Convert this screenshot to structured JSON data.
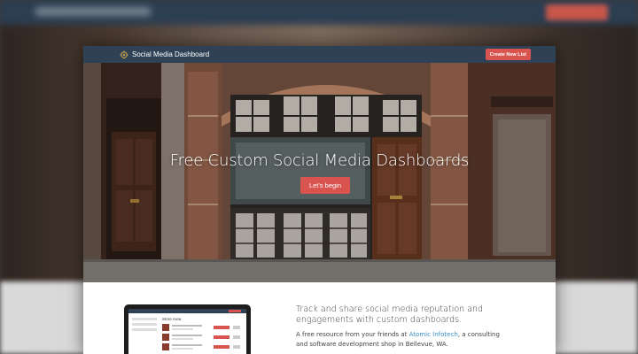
{
  "navbar": {
    "brand_icon": "gear-logo-icon",
    "brand_title": "Social Media Dashboard",
    "create_button": "Create New List"
  },
  "hero": {
    "title": "Free Custom Social Media Dashboards",
    "cta": "Let's begin"
  },
  "content": {
    "headline": "Track and share social media reputation and engagements with custom dashboards.",
    "body_prefix": "A free resource from your friends at ",
    "company_link": "Atomic Infotech",
    "body_suffix": ", a consulting and software development shop in Bellevue, WA.",
    "preview_title": "Store Area"
  },
  "colors": {
    "navbar": "#2e4155",
    "accent": "#d9534f",
    "link": "#3a8fc8"
  }
}
